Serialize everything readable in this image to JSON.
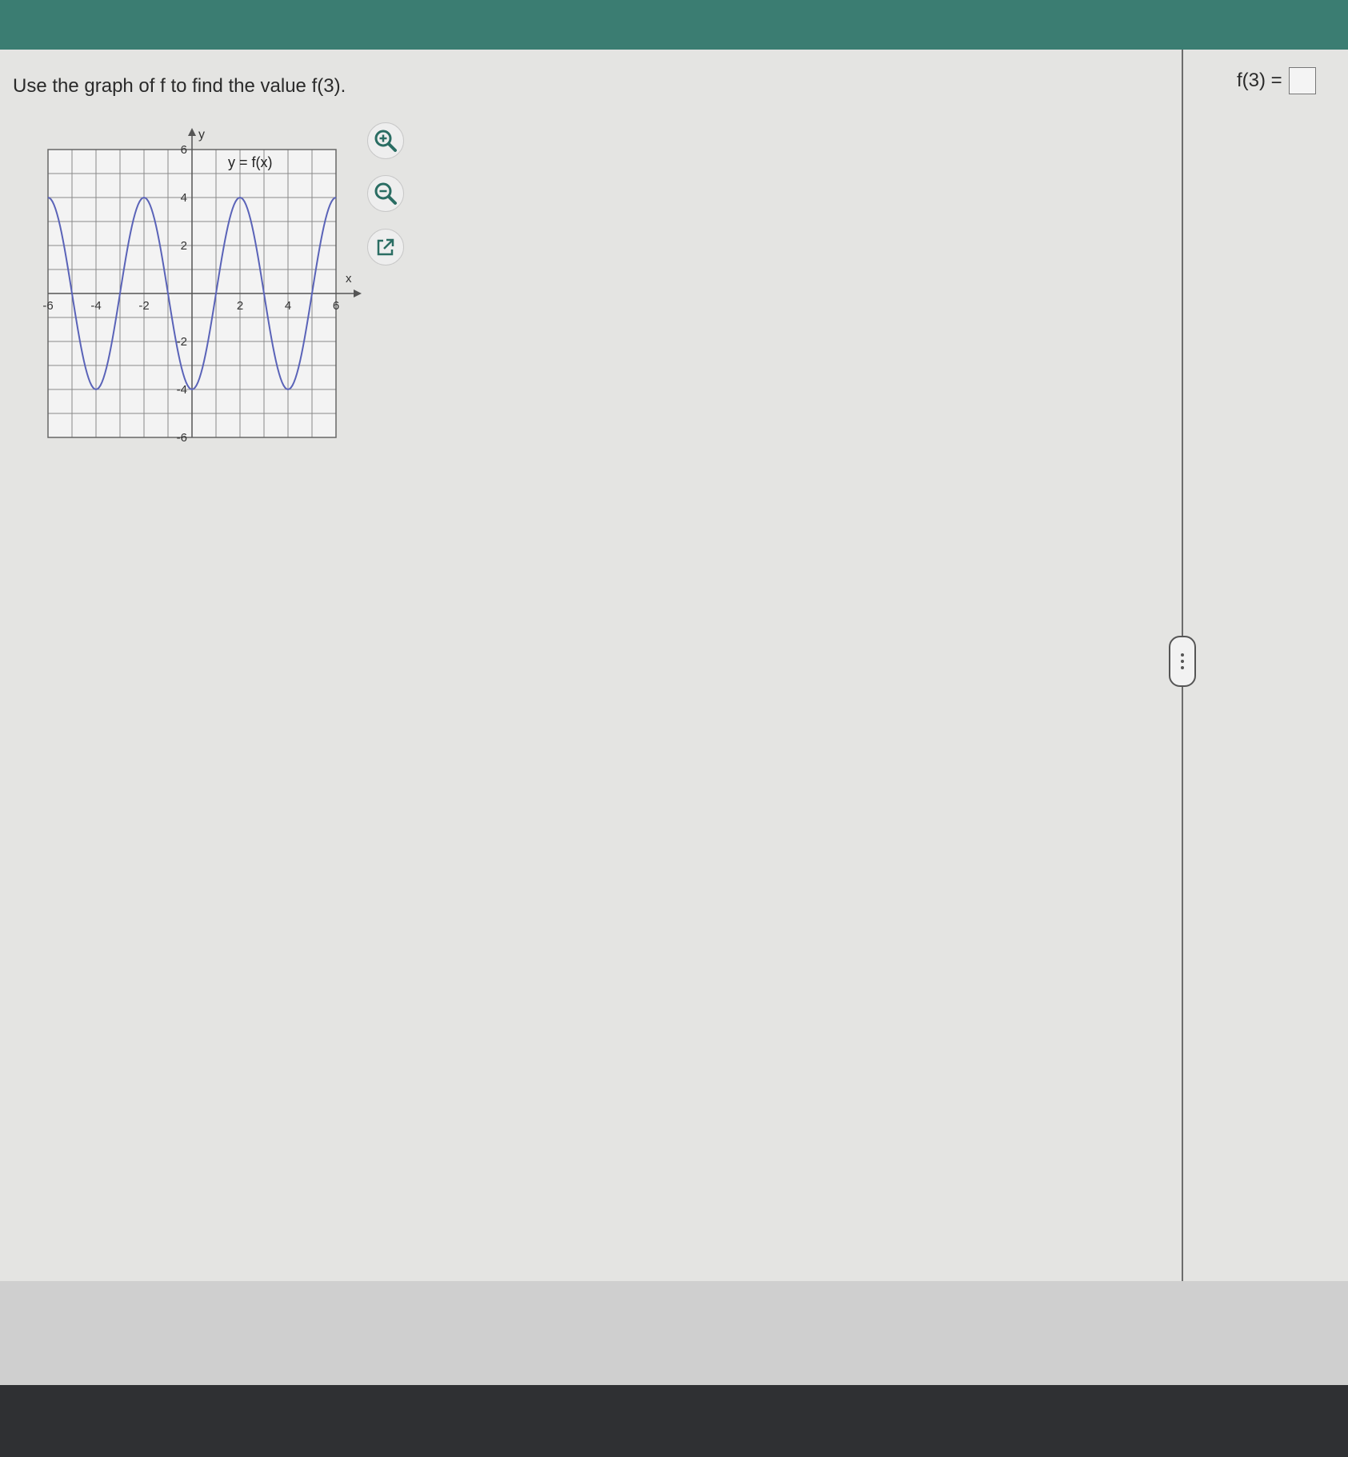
{
  "question": {
    "prompt": "Use the graph of f to find the value f(3)."
  },
  "answer": {
    "label": "f(3) =",
    "value": ""
  },
  "toolbar": {
    "zoom_in_icon": "zoom-in-icon",
    "zoom_out_icon": "zoom-out-icon",
    "popout_icon": "external-link-icon"
  },
  "colors": {
    "header": "#3b7d72",
    "curve": "#5a63b8",
    "grid": "#8a8a8a"
  },
  "chart_data": {
    "type": "line",
    "title": "y = f(x)",
    "xlabel": "x",
    "ylabel": "y",
    "xlim": [
      -6,
      6
    ],
    "ylim": [
      -6,
      6
    ],
    "grid": true,
    "x_ticks": [
      -6,
      -4,
      -2,
      2,
      4,
      6
    ],
    "y_ticks": [
      -6,
      -4,
      -2,
      2,
      4,
      6
    ],
    "x_tick_labels": [
      "-6",
      "-4",
      "-2",
      "2",
      "4",
      "6"
    ],
    "y_tick_labels": [
      "-6",
      "-4",
      "-2",
      "2",
      "4",
      "6"
    ],
    "series": [
      {
        "x": [
          -6,
          -5.5,
          -5,
          -4.5,
          -4,
          -3.5,
          -3,
          -2.5,
          -2,
          -1.5,
          -1,
          -0.5,
          0,
          0.5,
          1,
          1.5,
          2,
          2.5,
          3,
          3.5,
          4,
          4.5,
          5,
          5.5,
          6
        ],
        "y": [
          4,
          2.83,
          0,
          -2.83,
          -4,
          -2.83,
          0,
          2.83,
          4,
          2.83,
          0,
          -2.83,
          -4,
          -2.83,
          0,
          2.83,
          4,
          2.83,
          0,
          -2.83,
          -4,
          -2.83,
          0,
          2.83,
          4
        ]
      }
    ]
  }
}
